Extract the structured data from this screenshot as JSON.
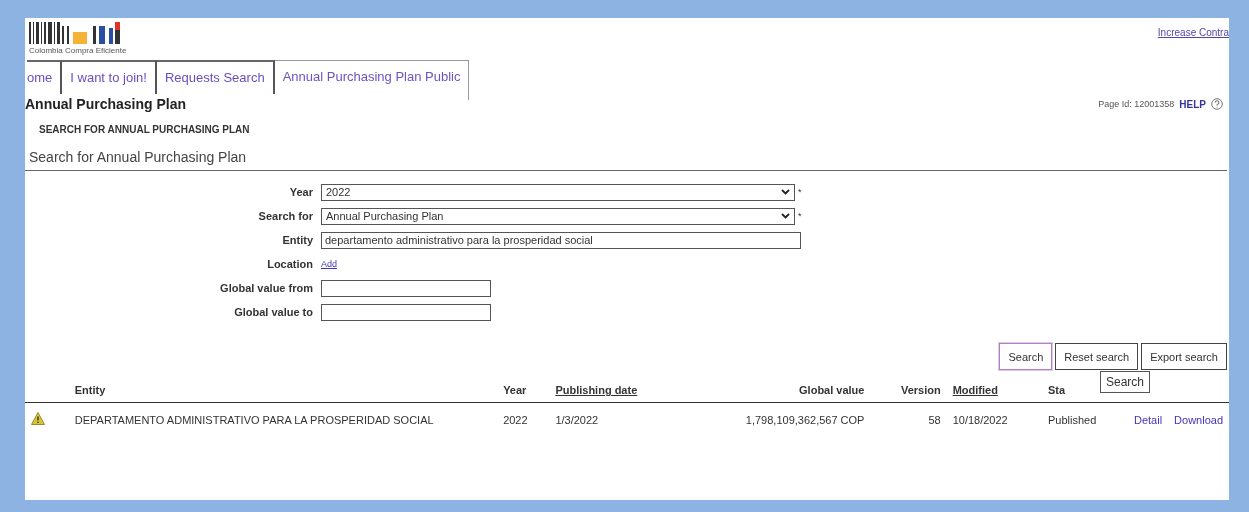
{
  "header": {
    "logo_text": "Colombia Compra Eficiente",
    "top_link": "Increase Contra"
  },
  "tabs": [
    {
      "label": "ome",
      "selected": false
    },
    {
      "label": "I want to join!",
      "selected": false
    },
    {
      "label": "Requests Search",
      "selected": false
    },
    {
      "label": "Annual Purchasing Plan Public",
      "selected": true
    }
  ],
  "page": {
    "title": "Annual Purchasing Plan",
    "page_id": "Page Id: 12001358",
    "help": "HELP",
    "subtitle": "SEARCH FOR ANNUAL PURCHASING PLAN",
    "section": "Search for Annual Purchasing Plan"
  },
  "form": [
    {
      "kind": "select",
      "label": "Year",
      "value": "2022",
      "mark": "*"
    },
    {
      "kind": "select",
      "label": "Search for",
      "value": "Annual Purchasing Plan",
      "mark": "*"
    },
    {
      "kind": "text",
      "label": "Entity",
      "value": "departamento administrativo para la prosperidad social"
    },
    {
      "kind": "link",
      "label": "Location",
      "value": "Add"
    },
    {
      "kind": "short",
      "label": "Global value from"
    },
    {
      "kind": "short",
      "label": "Global value to"
    }
  ],
  "buttons": [
    {
      "label": "Search",
      "focused": true
    },
    {
      "label": "Reset search",
      "focused": false
    },
    {
      "label": "Export search",
      "focused": false
    }
  ],
  "tooltip": "Search",
  "table": {
    "columns": [
      {
        "label": "Entity",
        "kind": "plain"
      },
      {
        "label": "Year",
        "kind": "plain"
      },
      {
        "label": "Publishing date",
        "kind": "sortable"
      },
      {
        "label": "Global value",
        "kind": "plain"
      },
      {
        "label": "Version",
        "kind": "plain"
      },
      {
        "label": "Modified",
        "kind": "sortable"
      },
      {
        "label": "Sta",
        "kind": "plain"
      }
    ],
    "rows": [
      {
        "warning": true,
        "cells": [
          "DEPARTAMENTO ADMINISTRATIVO PARA LA PROSPERIDAD SOCIAL",
          "2022",
          "1/3/2022",
          "1,798,109,362,567 COP",
          "58",
          "10/18/2022",
          "Published",
          "Detail",
          "Download"
        ]
      }
    ]
  }
}
